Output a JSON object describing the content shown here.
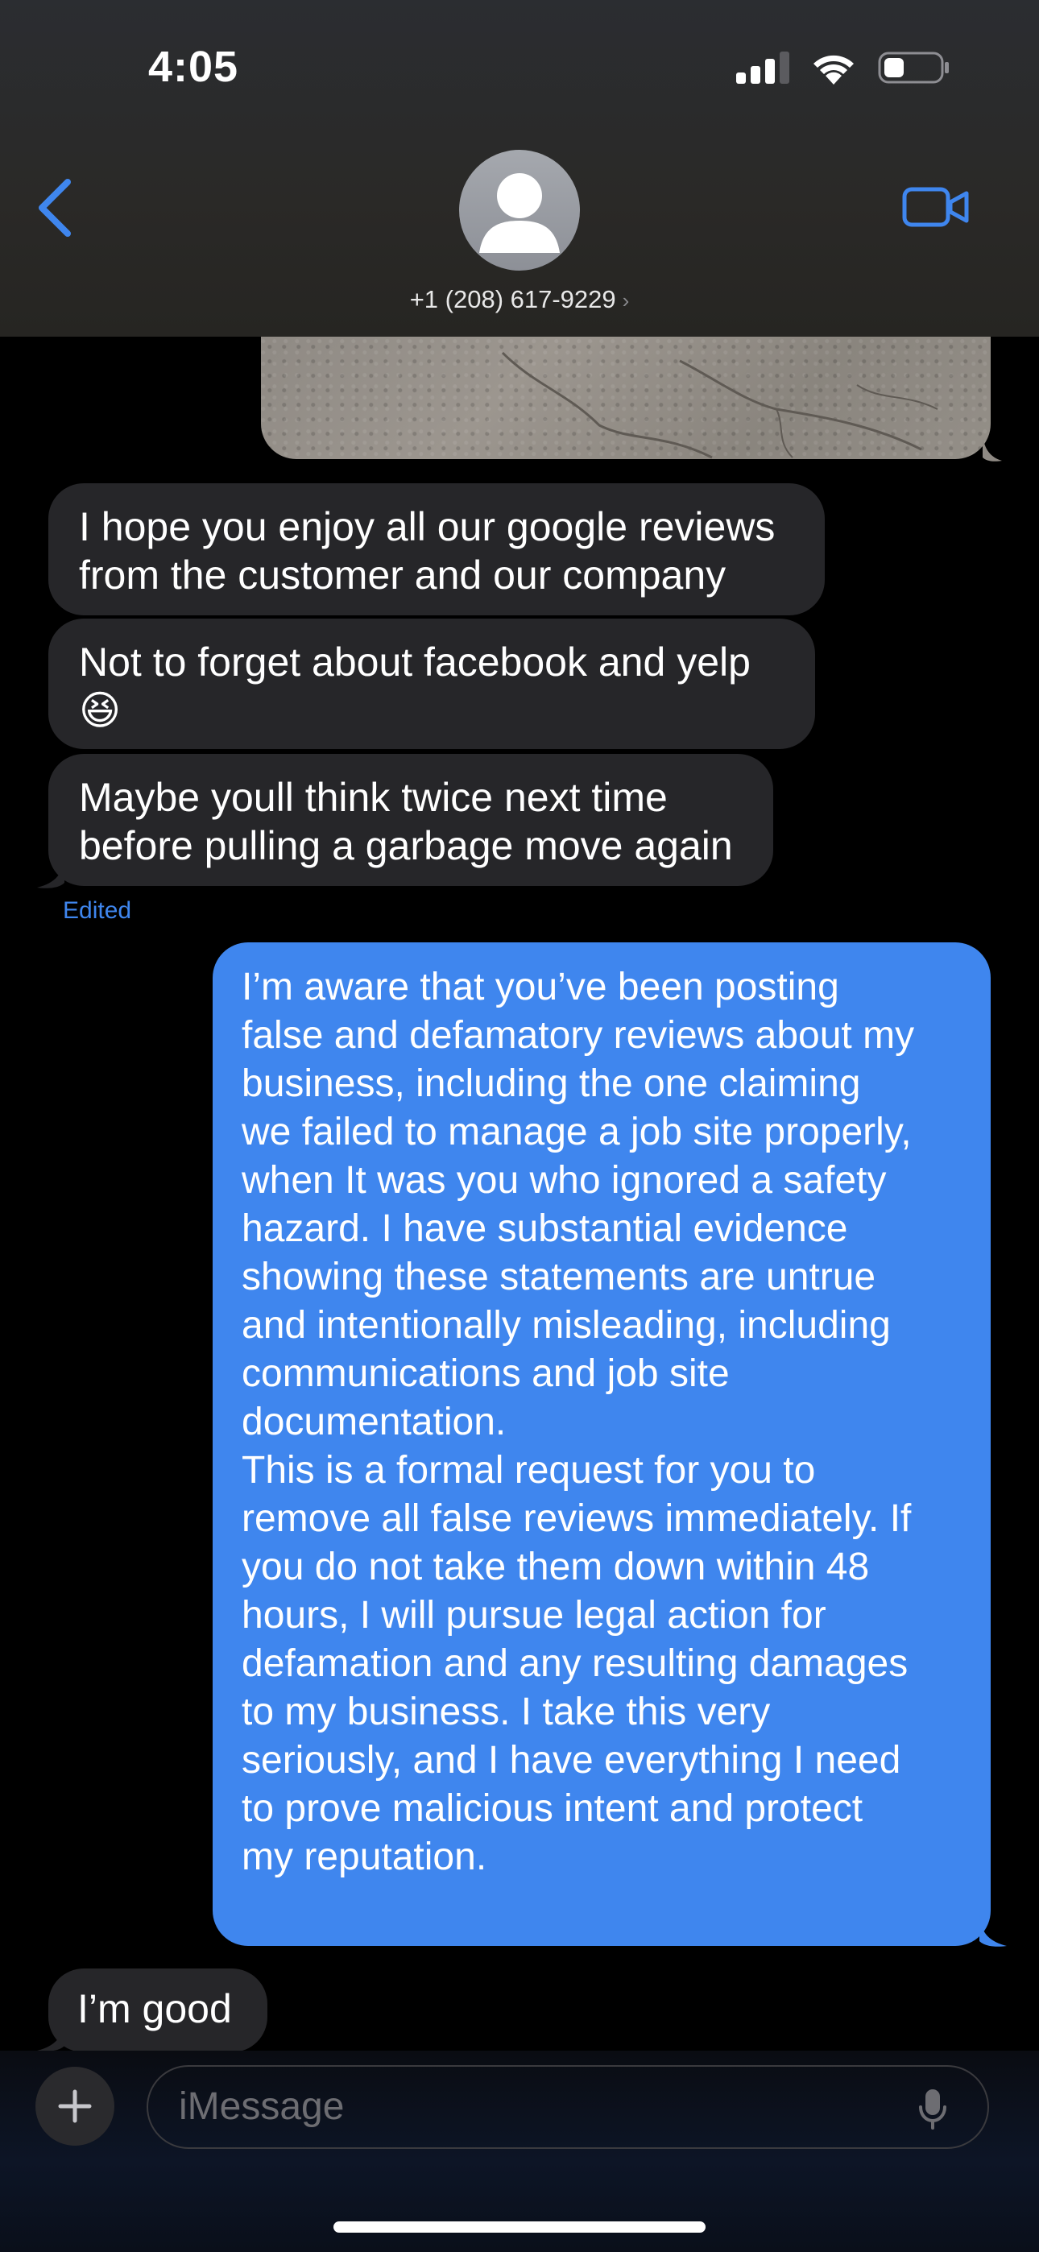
{
  "status_bar": {
    "time": "4:05"
  },
  "header": {
    "contact": "+1 (208) 617-9229"
  },
  "messages": [
    {
      "text": "I hope you enjoy all our google reviews\nfrom the customer and our company"
    },
    {
      "text": "Not to forget about facebook and yelp\n😆"
    },
    {
      "text": "Maybe youll think twice next time\nbefore pulling a garbage move again"
    },
    {
      "text": "I’m aware that you’ve been posting\nfalse and defamatory reviews about my\nbusiness, including the one claiming\nwe failed to manage a job site properly,\nwhen It was you who ignored a safety\nhazard. I have substantial evidence\nshowing these statements are untrue\nand intentionally misleading, including\ncommunications and job site\ndocumentation.\nThis is a formal request for you to\nremove all false reviews immediately. If\nyou do not take them down within 48\nhours, I will pursue legal action for\ndefamation and any resulting damages\nto my business. I take this very\nseriously, and I have everything I need\nto prove malicious intent and protect\nmy reputation."
    },
    {
      "text": "I’m good"
    }
  ],
  "edited_label": "Edited",
  "composer": {
    "placeholder": "iMessage"
  },
  "colors": {
    "accent": "#3f86ee",
    "incoming": "#262629",
    "outgoing": "#3f86ee"
  },
  "icons": [
    "back-chevron-icon",
    "video-camera-icon",
    "signal-icon",
    "wifi-icon",
    "battery-icon",
    "plus-icon",
    "microphone-icon"
  ]
}
